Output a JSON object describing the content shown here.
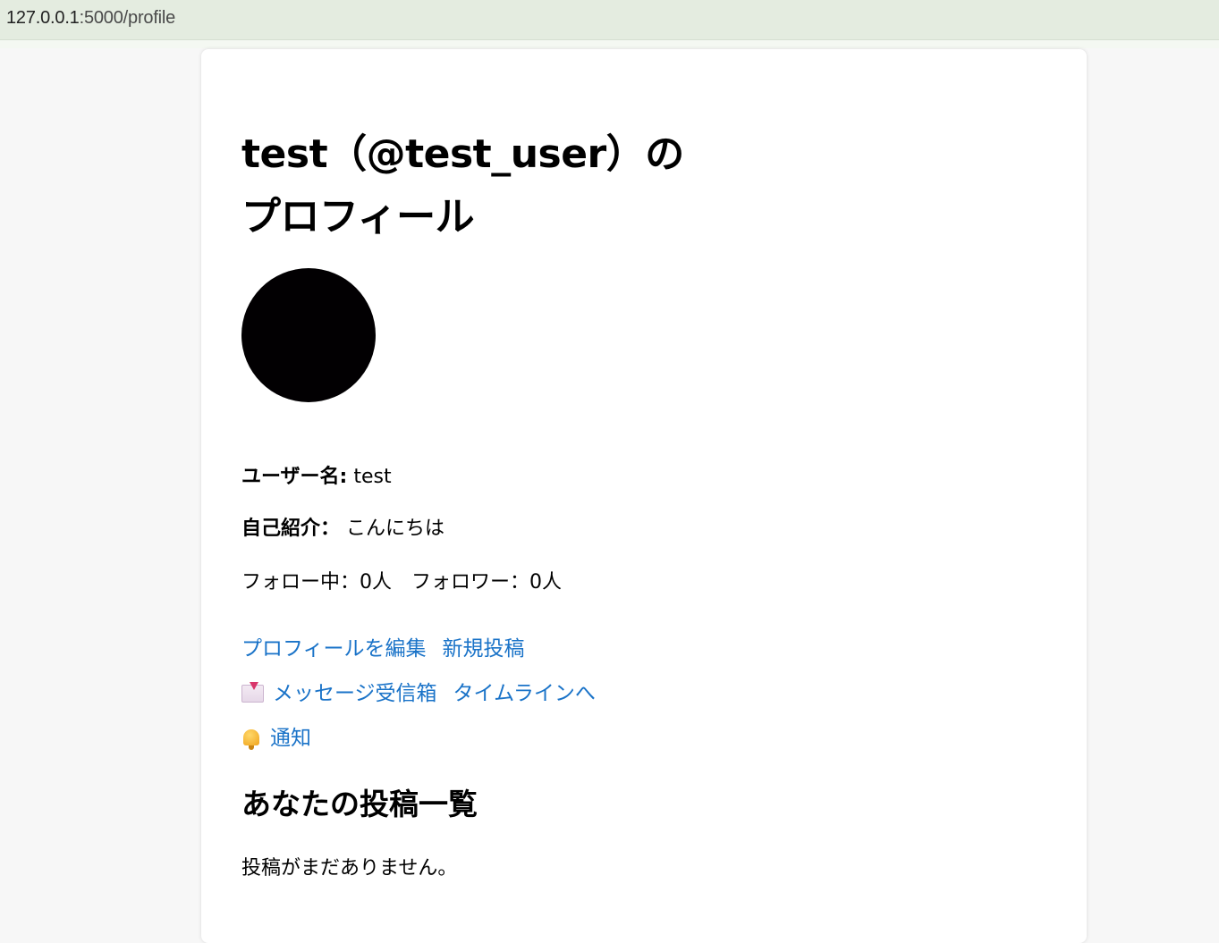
{
  "browser": {
    "url_host": "127.0.0.1",
    "url_path": ":5000/profile"
  },
  "profile": {
    "title_line1": "test（@test_user）の",
    "title_line2": "プロフィール",
    "username_label": "ユーザー名:",
    "username_value": "test",
    "bio_label": "自己紹介：",
    "bio_value": "こんにちは",
    "follow_stats": "フォロー中：0人　フォロワー：0人"
  },
  "links": {
    "edit_profile": "プロフィールを編集",
    "new_post": "新規投稿",
    "inbox": "メッセージ受信箱",
    "timeline": "タイムラインへ",
    "notifications": "通知"
  },
  "posts": {
    "heading": "あなたの投稿一覧",
    "empty_text": "投稿がまだありません。"
  },
  "icons": {
    "inbox": "inbox-tray-icon",
    "notifications": "bell-icon"
  },
  "colors": {
    "link": "#1a73c8",
    "avatar": "#020002"
  }
}
